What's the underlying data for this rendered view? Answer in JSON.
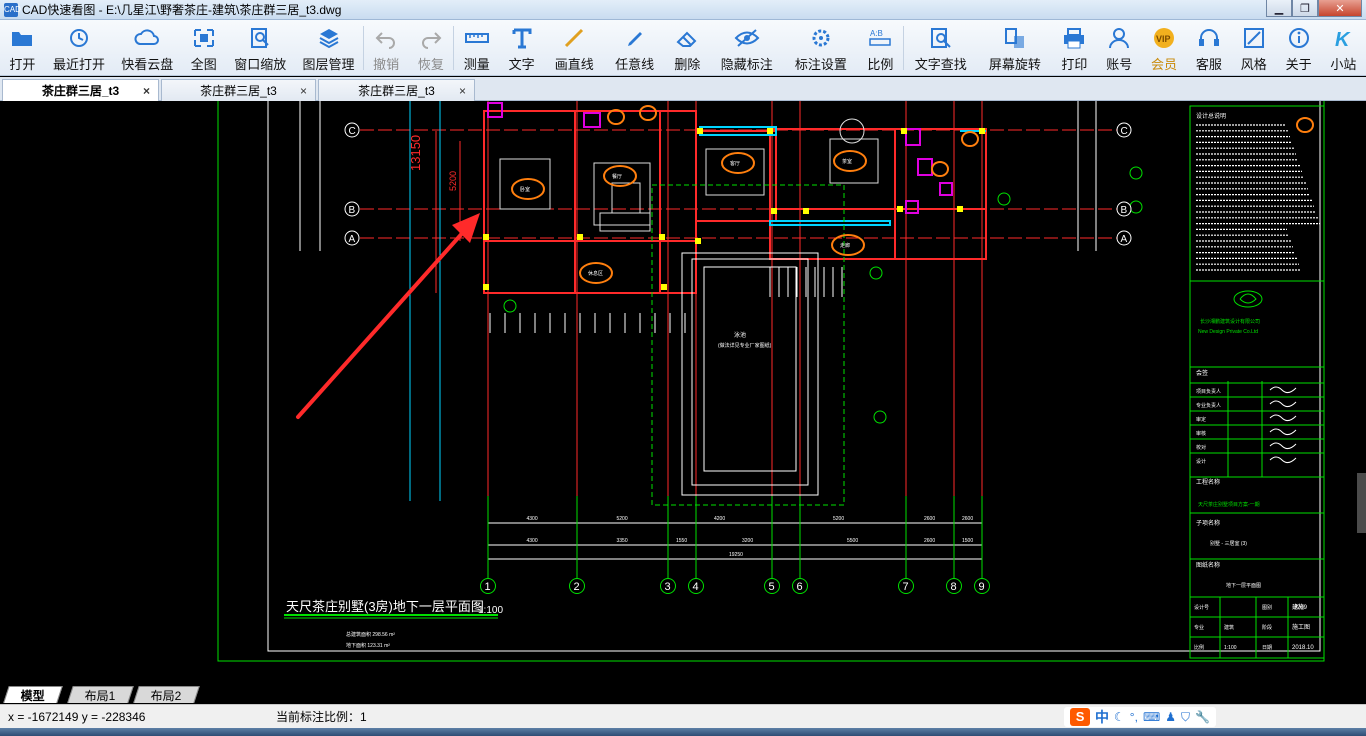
{
  "window": {
    "title": "CAD快速看图 - E:\\几星江\\野奢茶庄-建筑\\茶庄群三居_t3.dwg",
    "app_icon_text": "CAD"
  },
  "toolbar": [
    {
      "id": "open",
      "label": "打开",
      "icon": "folder-icon"
    },
    {
      "id": "recent",
      "label": "最近打开",
      "icon": "history-icon"
    },
    {
      "id": "cloud",
      "label": "快看云盘",
      "icon": "cloud-icon"
    },
    {
      "id": "fullview",
      "label": "全图",
      "icon": "fullscreen-icon"
    },
    {
      "id": "zoomwin",
      "label": "窗口缩放",
      "icon": "zoom-window-icon"
    },
    {
      "id": "layers",
      "label": "图层管理",
      "icon": "layers-icon"
    },
    {
      "id": "undo",
      "label": "撤销",
      "icon": "undo-icon",
      "disabled": true
    },
    {
      "id": "redo",
      "label": "恢复",
      "icon": "redo-icon",
      "disabled": true
    },
    {
      "id": "measure",
      "label": "测量",
      "icon": "ruler-icon"
    },
    {
      "id": "text",
      "label": "文字",
      "icon": "text-icon"
    },
    {
      "id": "line",
      "label": "画直线",
      "icon": "line-icon"
    },
    {
      "id": "freeline",
      "label": "任意线",
      "icon": "pen-icon"
    },
    {
      "id": "erase",
      "label": "删除",
      "icon": "eraser-icon"
    },
    {
      "id": "hide",
      "label": "隐藏标注",
      "icon": "eye-icon"
    },
    {
      "id": "dimset",
      "label": "标注设置",
      "icon": "dim-settings-icon"
    },
    {
      "id": "scale",
      "label": "比例",
      "icon": "scale-icon"
    },
    {
      "id": "find",
      "label": "文字查找",
      "icon": "text-search-icon"
    },
    {
      "id": "rotate",
      "label": "屏幕旋转",
      "icon": "rotate-icon"
    },
    {
      "id": "print",
      "label": "打印",
      "icon": "printer-icon"
    },
    {
      "id": "account",
      "label": "账号",
      "icon": "user-icon"
    },
    {
      "id": "vip",
      "label": "会员",
      "icon": "vip-icon",
      "vip": true,
      "badge": "VIP"
    },
    {
      "id": "service",
      "label": "客服",
      "icon": "headset-icon"
    },
    {
      "id": "style",
      "label": "风格",
      "icon": "style-icon"
    },
    {
      "id": "about",
      "label": "关于",
      "icon": "info-icon"
    },
    {
      "id": "site",
      "label": "小站",
      "icon": "k-logo-icon",
      "badge": "K"
    }
  ],
  "doc_tabs": [
    {
      "label": "茶庄群三居_t3",
      "active": true,
      "close": "×"
    },
    {
      "label": "茶庄群三居_t3",
      "active": false,
      "close": "×"
    },
    {
      "label": "茶庄群三居_t3",
      "active": false,
      "close": "×"
    }
  ],
  "drawing": {
    "plan_title": "天尺茶庄别墅(3房)地下一层平面图",
    "plan_scale": "1:100",
    "area_lines": [
      "总建筑面积   298.56 m²",
      "地下面积   123.31 m²"
    ],
    "row_axes": [
      "C",
      "B",
      "A"
    ],
    "column_axes": [
      "1",
      "2",
      "3",
      "4",
      "5",
      "6",
      "7",
      "8",
      "9"
    ],
    "dim_total": "19250",
    "dim_row1": [
      "4300",
      "5200",
      "4200",
      "5200",
      "2600",
      "2600"
    ],
    "dim_row2": [
      "4300",
      "3350",
      "1550",
      "3200",
      "5500",
      "2600",
      "1500"
    ],
    "side_dim": "13150",
    "side_dim2": "5200",
    "pool_label": "泳池",
    "pool_note": "(做法详见专业厂家图纸)",
    "room_tags": [
      "卧室",
      "餐厅",
      "客厅",
      "茶室",
      "休息区",
      "走廊"
    ],
    "titleblock": {
      "section1": "设计总说明",
      "company": "长沙湘鹏建筑设计有限公司",
      "company_en": "New Design  Private Co.Ltd",
      "sign_title": "会签",
      "signers": [
        "项目负责人",
        "专业负责人",
        "审定",
        "审核",
        "校对",
        "设计"
      ],
      "project_label": "工程名称",
      "project_name": "天尺茶庄别墅项目方案-一期",
      "subitem_label": "子项名称",
      "subitem_name": "别墅 - 三居室  (3)",
      "drawing_label": "图纸名称",
      "drawing_name": "地下一层平面图",
      "meta_rows": [
        [
          "设计号",
          "",
          "图别",
          "建施",
          "图号",
          "J209"
        ],
        [
          "专业",
          "建筑",
          "阶段",
          "施工图"
        ],
        [
          "比例",
          "1:100",
          "日期",
          "2018.10"
        ]
      ]
    },
    "colors": {
      "wall": "#ff2a2a",
      "green": "#00e000",
      "white": "#ffffff",
      "magenta": "#e000e0",
      "orange": "#ff7f0e",
      "cyan": "#00d4ff",
      "yellow": "#ffff00",
      "arrow": "#ff2a2a"
    }
  },
  "layout_tabs": [
    {
      "label": "模型",
      "active": true
    },
    {
      "label": "布局1",
      "active": false
    },
    {
      "label": "布局2",
      "active": false
    }
  ],
  "status": {
    "coords": "x = -1672149  y = -228346",
    "scale_text": "当前标注比例：1",
    "ime_logo": "S",
    "ime_lang": "中"
  }
}
